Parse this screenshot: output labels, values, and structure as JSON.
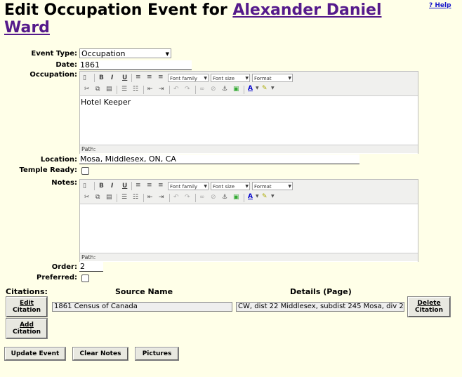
{
  "page": {
    "title_prefix": "Edit Occupation Event for ",
    "person_name": "Alexander Daniel Ward",
    "help_link": "? Help"
  },
  "form": {
    "event_type_label": "Event Type:",
    "event_type_value": "Occupation",
    "date_label": "Date:",
    "date_value": "1861",
    "occupation_label": "Occupation:",
    "occupation_value": "Hotel Keeper",
    "location_label": "Location:",
    "location_value": "Mosa, Middlesex, ON, CA",
    "temple_ready_label": "Temple Ready:",
    "notes_label": "Notes:",
    "notes_value": "",
    "order_label": "Order:",
    "order_value": "2",
    "preferred_label": "Preferred:"
  },
  "editor_toolbar": {
    "font_family": "Font family",
    "font_size": "Font size",
    "format": "Format",
    "path_label": "Path:"
  },
  "citations": {
    "label": "Citations:",
    "source_header": "Source Name",
    "details_header": "Details (Page)",
    "rows": [
      {
        "source": "1861 Census of Canada",
        "details": "CW, dist 22 Middlesex, subdist 245 Mosa, div 2 p"
      }
    ],
    "edit_button_l1": "Edit",
    "edit_button_l2": "Citation",
    "delete_button_l1": "Delete",
    "delete_button_l2": "Citation",
    "add_button_l1": "Add",
    "add_button_l2": "Citation"
  },
  "buttons": {
    "update_event": "Update Event",
    "clear_notes": "Clear Notes",
    "pictures": "Pictures"
  }
}
